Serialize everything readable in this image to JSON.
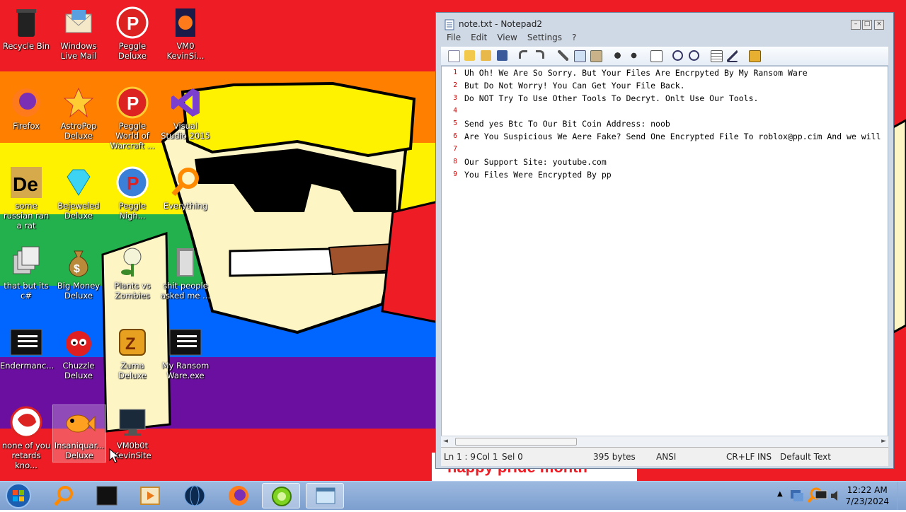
{
  "desktop": {
    "icons": [
      {
        "label": "Recycle Bin"
      },
      {
        "label": "Windows Live Mail"
      },
      {
        "label": "Peggle Deluxe"
      },
      {
        "label": "VM0 KevinSi..."
      },
      {
        "label": "Firefox"
      },
      {
        "label": "AstroPop Deluxe"
      },
      {
        "label": "Peggle World of Warcraft ..."
      },
      {
        "label": "Visual Studio 2015"
      },
      {
        "label": "some russian ran a rat"
      },
      {
        "label": "Bejeweled Deluxe"
      },
      {
        "label": "Peggle Nigh..."
      },
      {
        "label": "Everything"
      },
      {
        "label": "that but its c#"
      },
      {
        "label": "Big Money Deluxe"
      },
      {
        "label": "Plants vs Zombies"
      },
      {
        "label": "shit people asked me ..."
      },
      {
        "label": "Endermanc..."
      },
      {
        "label": "Chuzzle Deluxe"
      },
      {
        "label": "Zuma Deluxe"
      },
      {
        "label": "My Ransom Ware.exe"
      },
      {
        "label": "none of you retards kno..."
      },
      {
        "label": "Insaniquar... Deluxe"
      },
      {
        "label": "VM0b0t KevinSite"
      }
    ],
    "wallpaper_caption": "happy pride month",
    "colors": {
      "red": "#ee1c24",
      "orange": "#ff7f00",
      "yellow": "#fff200",
      "green": "#22b14c",
      "blue": "#0066ff",
      "purple": "#6b0fa0"
    }
  },
  "notepad": {
    "title": "note.txt - Notepad2",
    "menu": [
      "File",
      "Edit",
      "View",
      "Settings",
      "?"
    ],
    "lines": [
      {
        "n": "1",
        "text": "Uh Oh! We Are So Sorry. But Your Files Are Encrpyted By My Ransom Ware"
      },
      {
        "n": "2",
        "text": "But Do Not Worry! You Can Get Your File Back."
      },
      {
        "n": "3",
        "text": "Do NOT Try To Use Other Tools To Decryt. Onlt Use Our Tools."
      },
      {
        "n": "4",
        "text": ""
      },
      {
        "n": "5",
        "text": "Send yes Btc To Our Bit Coin Address: noob"
      },
      {
        "n": "6",
        "text": "Are You Suspicious We Aere Fake? Send One Encrypted File To roblox@pp.cim And we will"
      },
      {
        "n": "7",
        "text": ""
      },
      {
        "n": "8",
        "text": "Our Support Site: youtube.com"
      },
      {
        "n": "9",
        "text": "You Files Were Encrypted By pp"
      }
    ],
    "status": {
      "pos": "Ln 1 : 9",
      "col": "Col 1",
      "sel": "Sel 0",
      "size": "395 bytes",
      "encoding": "ANSI",
      "eol": "CR+LF",
      "mode": "INS",
      "scheme": "Default Text"
    }
  },
  "taskbar": {
    "items": [
      "start-orb",
      "search-everything",
      "cmd",
      "media-player",
      "globe",
      "firefox",
      "lime",
      "explorer"
    ],
    "time": "12:22 AM",
    "date": "7/23/2024"
  }
}
